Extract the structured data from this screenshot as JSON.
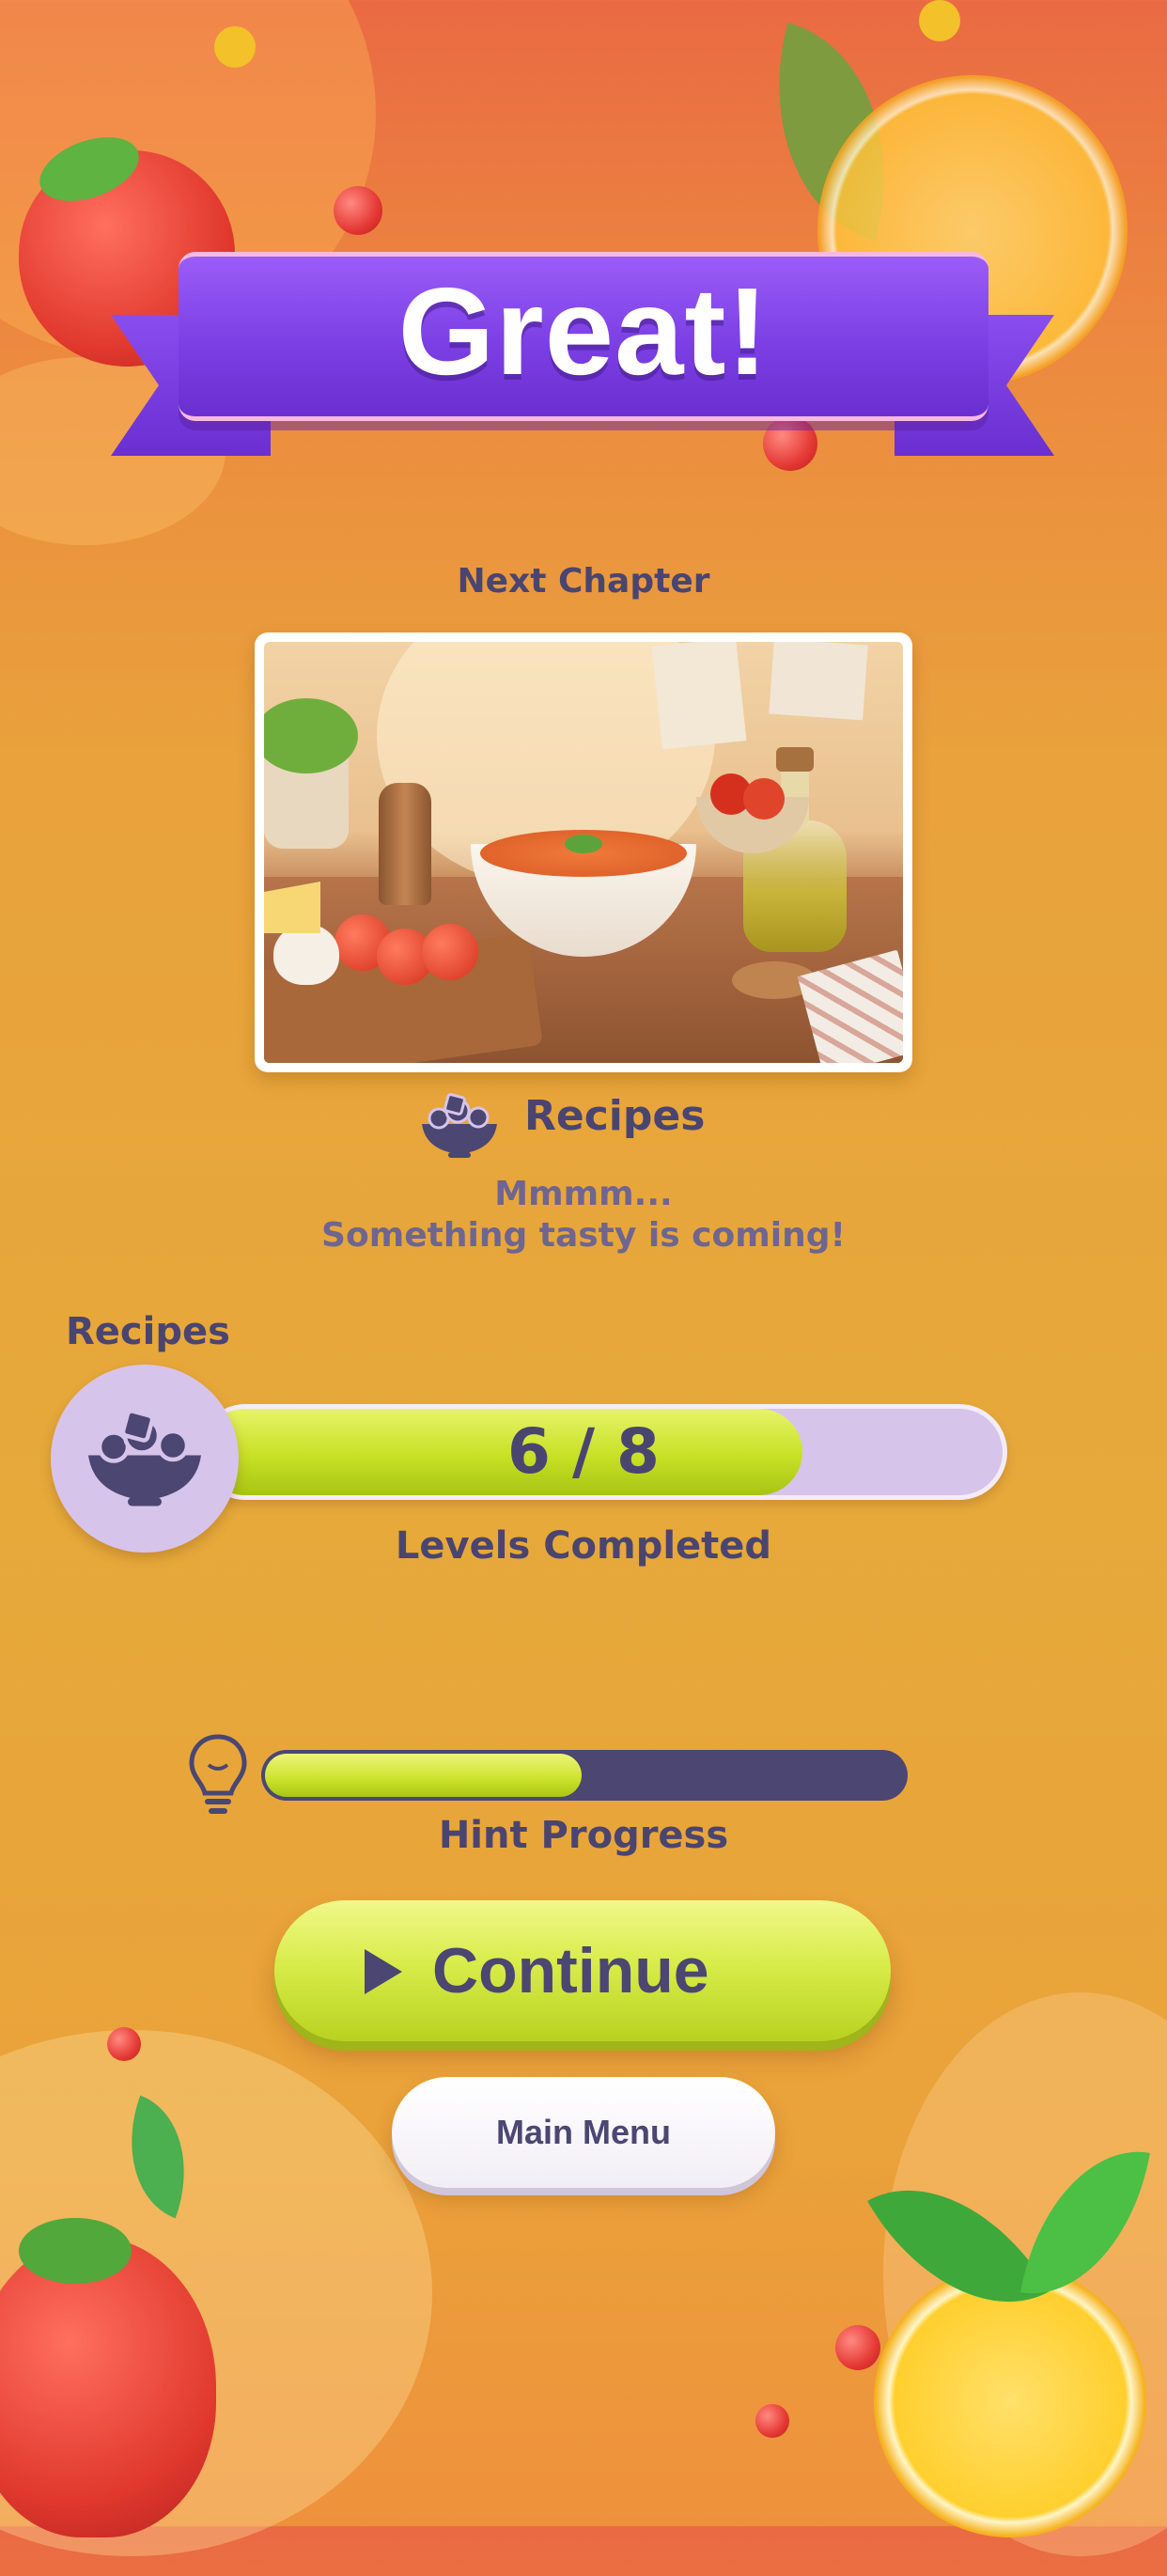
{
  "banner": {
    "title": "Great!"
  },
  "chapter": {
    "heading": "Next Chapter",
    "name": "Recipes",
    "message_line1": "Mmmm...",
    "message_line2": "Something tasty is coming!"
  },
  "progress": {
    "label": "Recipes",
    "completed": 6,
    "total": 8,
    "display": "6 / 8",
    "caption": "Levels Completed"
  },
  "hint": {
    "caption": "Hint Progress",
    "fraction": 0.49
  },
  "buttons": {
    "continue_label": "Continue",
    "menu_label": "Main Menu"
  },
  "icons": {
    "chapter_icon": "salad-bowl-icon",
    "progress_icon": "salad-bowl-icon",
    "hint_icon": "lightbulb-icon",
    "continue_icon": "play-icon"
  },
  "colors": {
    "banner_purple": "#7b3fe4",
    "text_dark": "#4a4570",
    "progress_green": "#c7e125",
    "progress_track": "#d7c4ea",
    "hint_track": "#4b4672"
  }
}
